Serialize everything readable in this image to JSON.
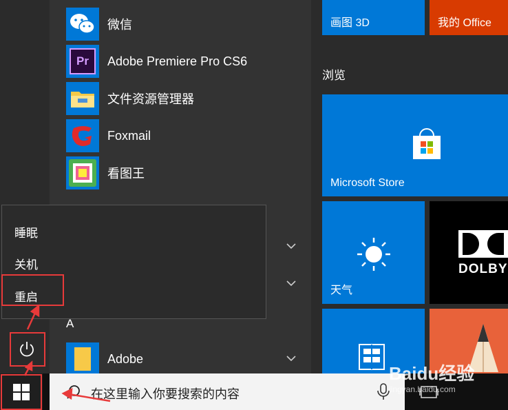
{
  "app_list": {
    "items": [
      {
        "label": "微信",
        "icon": "wechat-icon"
      },
      {
        "label": "Adobe Premiere Pro CS6",
        "icon": "premiere-icon"
      },
      {
        "label": "文件资源管理器",
        "icon": "folder-icon"
      },
      {
        "label": "Foxmail",
        "icon": "foxmail-icon"
      },
      {
        "label": "看图王",
        "icon": "image-viewer-icon"
      }
    ],
    "group_letter": "A",
    "adobe_item": {
      "label": "Adobe",
      "icon": "folder-icon"
    }
  },
  "power_menu": {
    "items": [
      {
        "label": "睡眠"
      },
      {
        "label": "关机"
      },
      {
        "label": "重启"
      }
    ]
  },
  "tiles": {
    "paint3d": {
      "label": "画图 3D",
      "color": "#0078d7"
    },
    "my_office": {
      "label": "我的 Office",
      "color": "#d83b01"
    },
    "section_browse": "浏览",
    "store": {
      "label": "Microsoft Store",
      "color": "#0078d7"
    },
    "dolby": {
      "label": "DOLBY",
      "color": "#000000"
    },
    "weather": {
      "label": "天气",
      "color": "#0078d7"
    },
    "winrar": {
      "color": "#0078d7"
    },
    "sketch": {
      "color": "#e8623a"
    }
  },
  "taskbar": {
    "search_placeholder": "在这里输入你要搜索的内容"
  },
  "watermark": {
    "text": "Baidu经验",
    "sub": "jingyan.baidu.com"
  },
  "colors": {
    "accent": "#0078d7",
    "annotation": "#e83a3a"
  }
}
